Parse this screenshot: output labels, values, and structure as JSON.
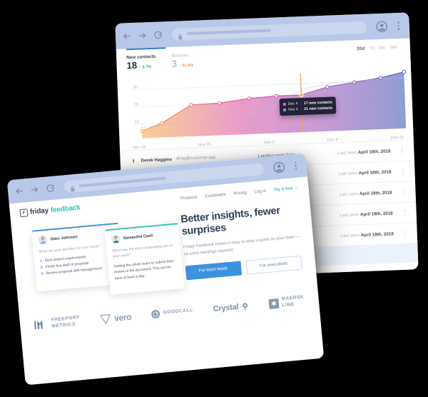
{
  "background_color": "#000000",
  "analytics_window": {
    "chrome": {
      "back_icon": "back-arrow-icon",
      "forward_icon": "forward-arrow-icon",
      "reload_icon": "reload-icon",
      "lock_icon": "lock-icon",
      "url_value": "",
      "account_icon": "account-avatar-icon",
      "menu_icon": "kebab-menu-icon"
    },
    "metrics": [
      {
        "label": "New contacts",
        "value": "18",
        "delta": "↑ 2.7%",
        "delta_color": "#23b07e"
      },
      {
        "label": "Sources",
        "value": "3",
        "delta": "↑ 31.4%",
        "delta_color": "#f08a3c"
      }
    ],
    "ranges": {
      "active": "30d",
      "options": [
        "7d",
        "Mo",
        "We"
      ]
    },
    "tooltip": [
      {
        "swatch": "#e06bb0",
        "date": "Dec 4",
        "text": "17 new contacts"
      },
      {
        "swatch": "#6f7fc4",
        "date": "Nov 4",
        "text": "21 new contacts"
      }
    ],
    "rows": [
      {
        "name": "Derek Haggins",
        "email": "dhag@customer.app",
        "source": "Landing page form",
        "seen_prefix": "Last seen ",
        "seen_date": "April 18th, 2018"
      },
      {
        "name": "",
        "email": "",
        "source": "",
        "seen_prefix": "Last seen ",
        "seen_date": "April 18th, 2018"
      },
      {
        "name": "",
        "email": "",
        "source": "",
        "seen_prefix": "Last seen ",
        "seen_date": "April 18th, 2018"
      },
      {
        "name": "",
        "email": "",
        "source": "",
        "seen_prefix": "Last seen ",
        "seen_date": "April 18th, 2018"
      },
      {
        "name": "",
        "email": "",
        "source": "",
        "seen_prefix": "Last seen ",
        "seen_date": "April 18th, 2018"
      }
    ]
  },
  "marketing_window": {
    "chrome": {
      "back_icon": "back-arrow-icon",
      "forward_icon": "forward-arrow-icon",
      "reload_icon": "reload-icon",
      "lock_icon": "lock-icon",
      "url_value": "",
      "account_icon": "account-avatar-icon",
      "menu_icon": "kebab-menu-icon"
    },
    "brand": {
      "mark": "F",
      "word_one": "friday",
      "word_two": "feedback",
      "accent": "#2ec7b4"
    },
    "nav": [
      "Products",
      "Customers",
      "Pricing",
      "Log in"
    ],
    "nav_cta": "Try it free →",
    "hero": {
      "heading": "Better insights, fewer surprises",
      "subheading": "Friday Feedback makes it easy to keep a pulse on your team — no extra meetings required.",
      "primary_button": "For team leads",
      "secondary_button": "For executives"
    },
    "feedback_cards": [
      {
        "accent": "#3d92de",
        "name": "Staci Johnson",
        "question": "What are your priorities for next week?",
        "items": [
          "Elicit project requirements",
          "Finish fina draft of proposal",
          "Review proposal with management"
        ]
      },
      {
        "accent": "#2ec7b4",
        "name": "Samantha Cash",
        "question": "What was the most challenging part of your week?",
        "answer": "Getting the whole team to submit their review of the document. This set me back at least a day."
      }
    ],
    "logos": [
      {
        "name": "freeport-metrics",
        "line1": "FREEPORT",
        "line2": "METRICS"
      },
      {
        "name": "vero",
        "text": "vero"
      },
      {
        "name": "goodcall",
        "text": "GOODCALL"
      },
      {
        "name": "crystal",
        "text": "Crystal"
      },
      {
        "name": "maersk-line",
        "line1": "MAERSK",
        "line2": "LINE"
      }
    ]
  },
  "chart_data": {
    "type": "area",
    "title": "New contacts",
    "xlabel": "",
    "ylabel": "",
    "x_tick_labels": [
      "Nov 19",
      "Nov 25",
      "Dec 2",
      "Dec 9",
      "Dec 18"
    ],
    "y_tick_labels": [
      "10",
      "20",
      "30"
    ],
    "ylim": [
      0,
      35
    ],
    "grid": true,
    "legend": "none",
    "highlight_x": "Dec 4",
    "series": [
      {
        "name": "New contacts",
        "style": "solid-area-gradient",
        "gradient": [
          "#f7b267",
          "#e06bb0",
          "#6f7fc4"
        ],
        "points": [
          {
            "x": "Nov 19",
            "y": 8
          },
          {
            "x": "Nov 20",
            "y": 12
          },
          {
            "x": "Nov 22",
            "y": 18
          },
          {
            "x": "Nov 24",
            "y": 18.5
          },
          {
            "x": "Nov 26",
            "y": 20
          },
          {
            "x": "Nov 29",
            "y": 22
          },
          {
            "x": "Dec 2",
            "y": 22
          },
          {
            "x": "Dec 4",
            "y": 22
          },
          {
            "x": "Dec 7",
            "y": 26
          },
          {
            "x": "Dec 11",
            "y": 28
          },
          {
            "x": "Dec 15",
            "y": 30
          },
          {
            "x": "Dec 18",
            "y": 33
          }
        ]
      },
      {
        "name": "Previous period",
        "style": "dotted-line",
        "color": "#b9bcd6",
        "points": [
          {
            "x": "Nov 19",
            "y": 10
          },
          {
            "x": "Nov 22",
            "y": 11.5
          },
          {
            "x": "Nov 26",
            "y": 12
          },
          {
            "x": "Nov 29",
            "y": 13.5
          },
          {
            "x": "Dec 2",
            "y": 18
          },
          {
            "x": "Dec 4",
            "y": 24
          },
          {
            "x": "Dec 7",
            "y": 27.5
          },
          {
            "x": "Dec 11",
            "y": 28.5
          },
          {
            "x": "Dec 15",
            "y": 29
          },
          {
            "x": "Dec 18",
            "y": 29.5
          }
        ]
      }
    ]
  }
}
